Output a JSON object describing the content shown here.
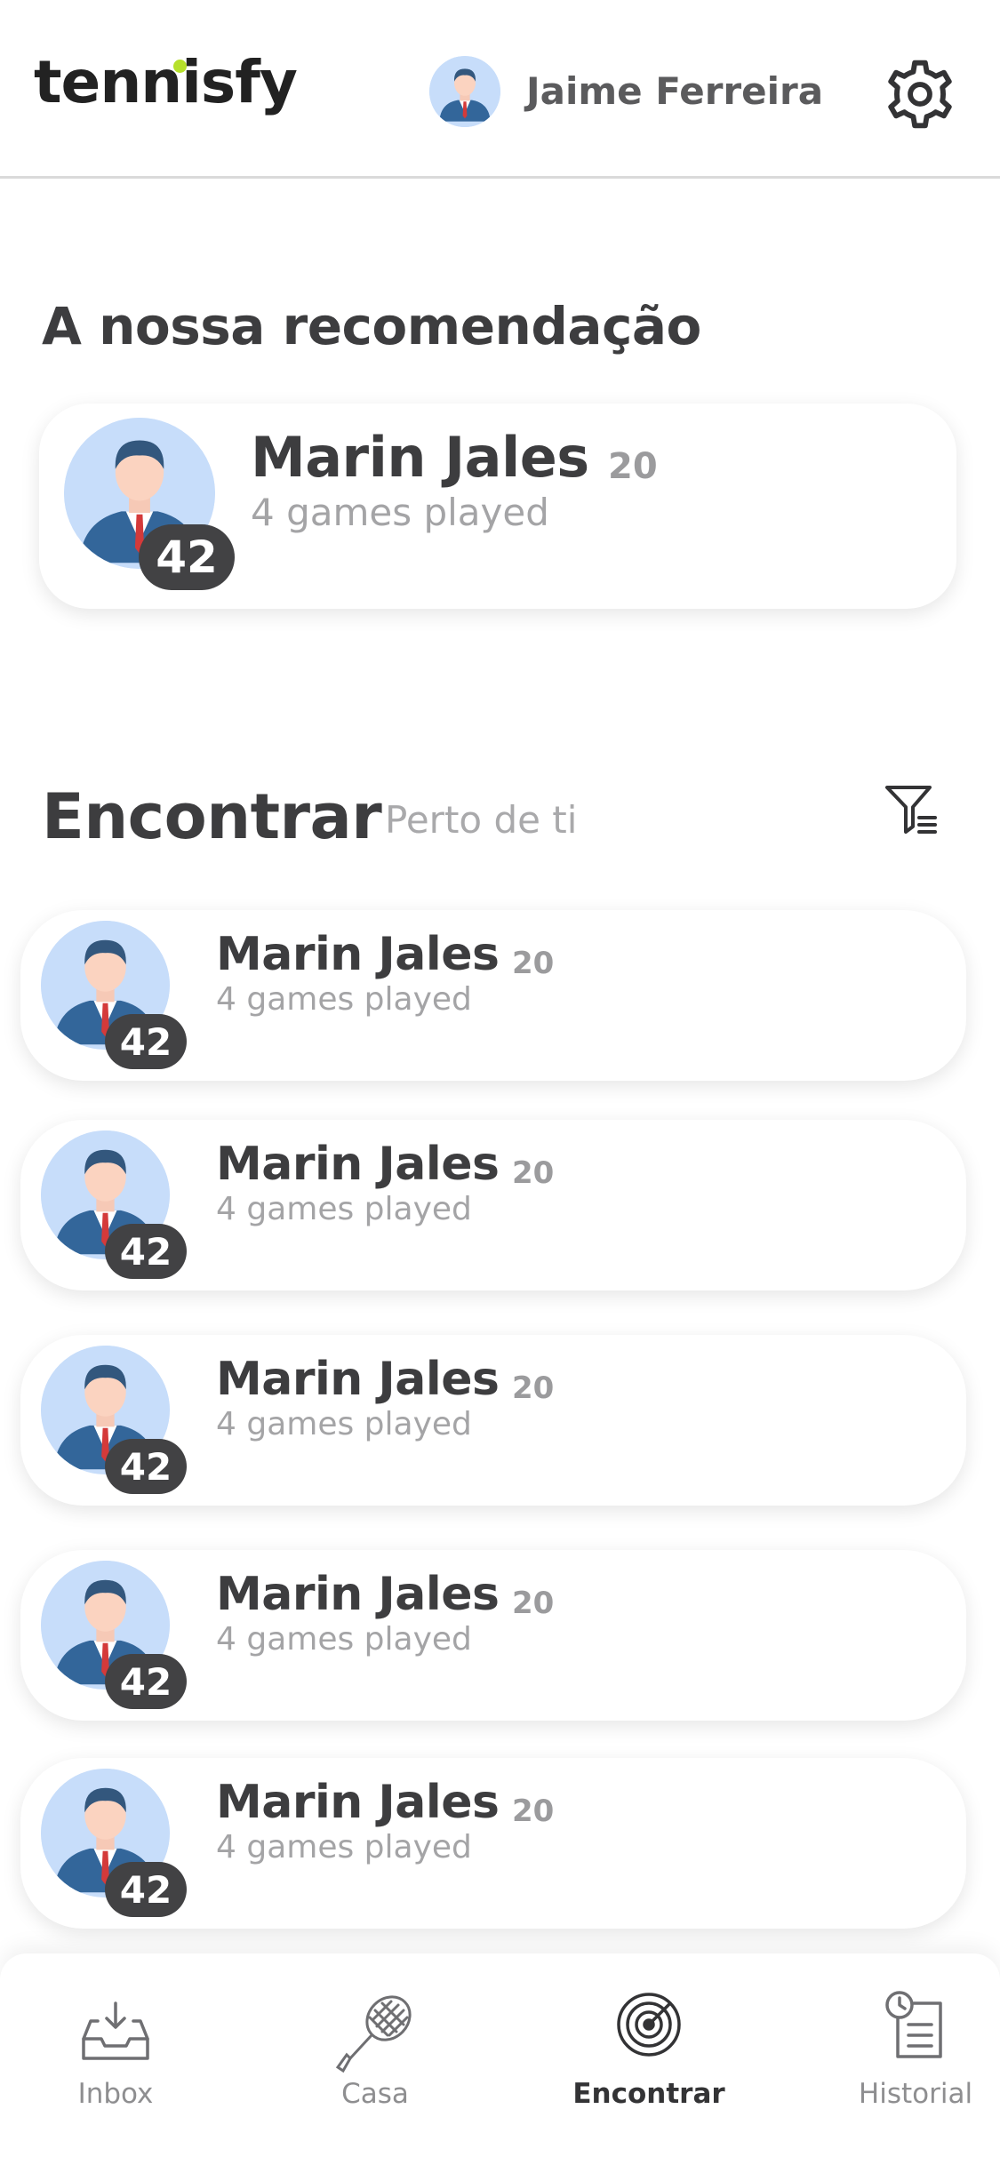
{
  "header": {
    "logo": "tennisfy",
    "user_name": "Jaime Ferreira"
  },
  "recommendation": {
    "title": "A nossa recomendação",
    "player": {
      "name": "Marin Jales",
      "age": "20",
      "games": "4 games played",
      "rating": "42"
    }
  },
  "find": {
    "title": "Encontrar",
    "subtitle": "Perto de ti"
  },
  "players": [
    {
      "name": "Marin Jales",
      "age": "20",
      "games": "4 games played",
      "rating": "42"
    },
    {
      "name": "Marin Jales",
      "age": "20",
      "games": "4 games played",
      "rating": "42"
    },
    {
      "name": "Marin Jales",
      "age": "20",
      "games": "4 games played",
      "rating": "42"
    },
    {
      "name": "Marin Jales",
      "age": "20",
      "games": "4 games played",
      "rating": "42"
    },
    {
      "name": "Marin Jales",
      "age": "20",
      "games": "4 games played",
      "rating": "42"
    }
  ],
  "nav": {
    "items": [
      {
        "label": "Inbox",
        "icon": "inbox-icon",
        "active": false
      },
      {
        "label": "Casa",
        "icon": "tennis-racket-icon",
        "active": false
      },
      {
        "label": "Encontrar",
        "icon": "radar-icon",
        "active": true
      },
      {
        "label": "Historial",
        "icon": "history-icon",
        "active": false
      }
    ]
  },
  "colors": {
    "accent": "#b6e02b",
    "badge": "#424244",
    "avatar_bg": "#c7ddfa",
    "text_dark": "#3d3d3f",
    "text_muted": "#a4a4a6"
  }
}
